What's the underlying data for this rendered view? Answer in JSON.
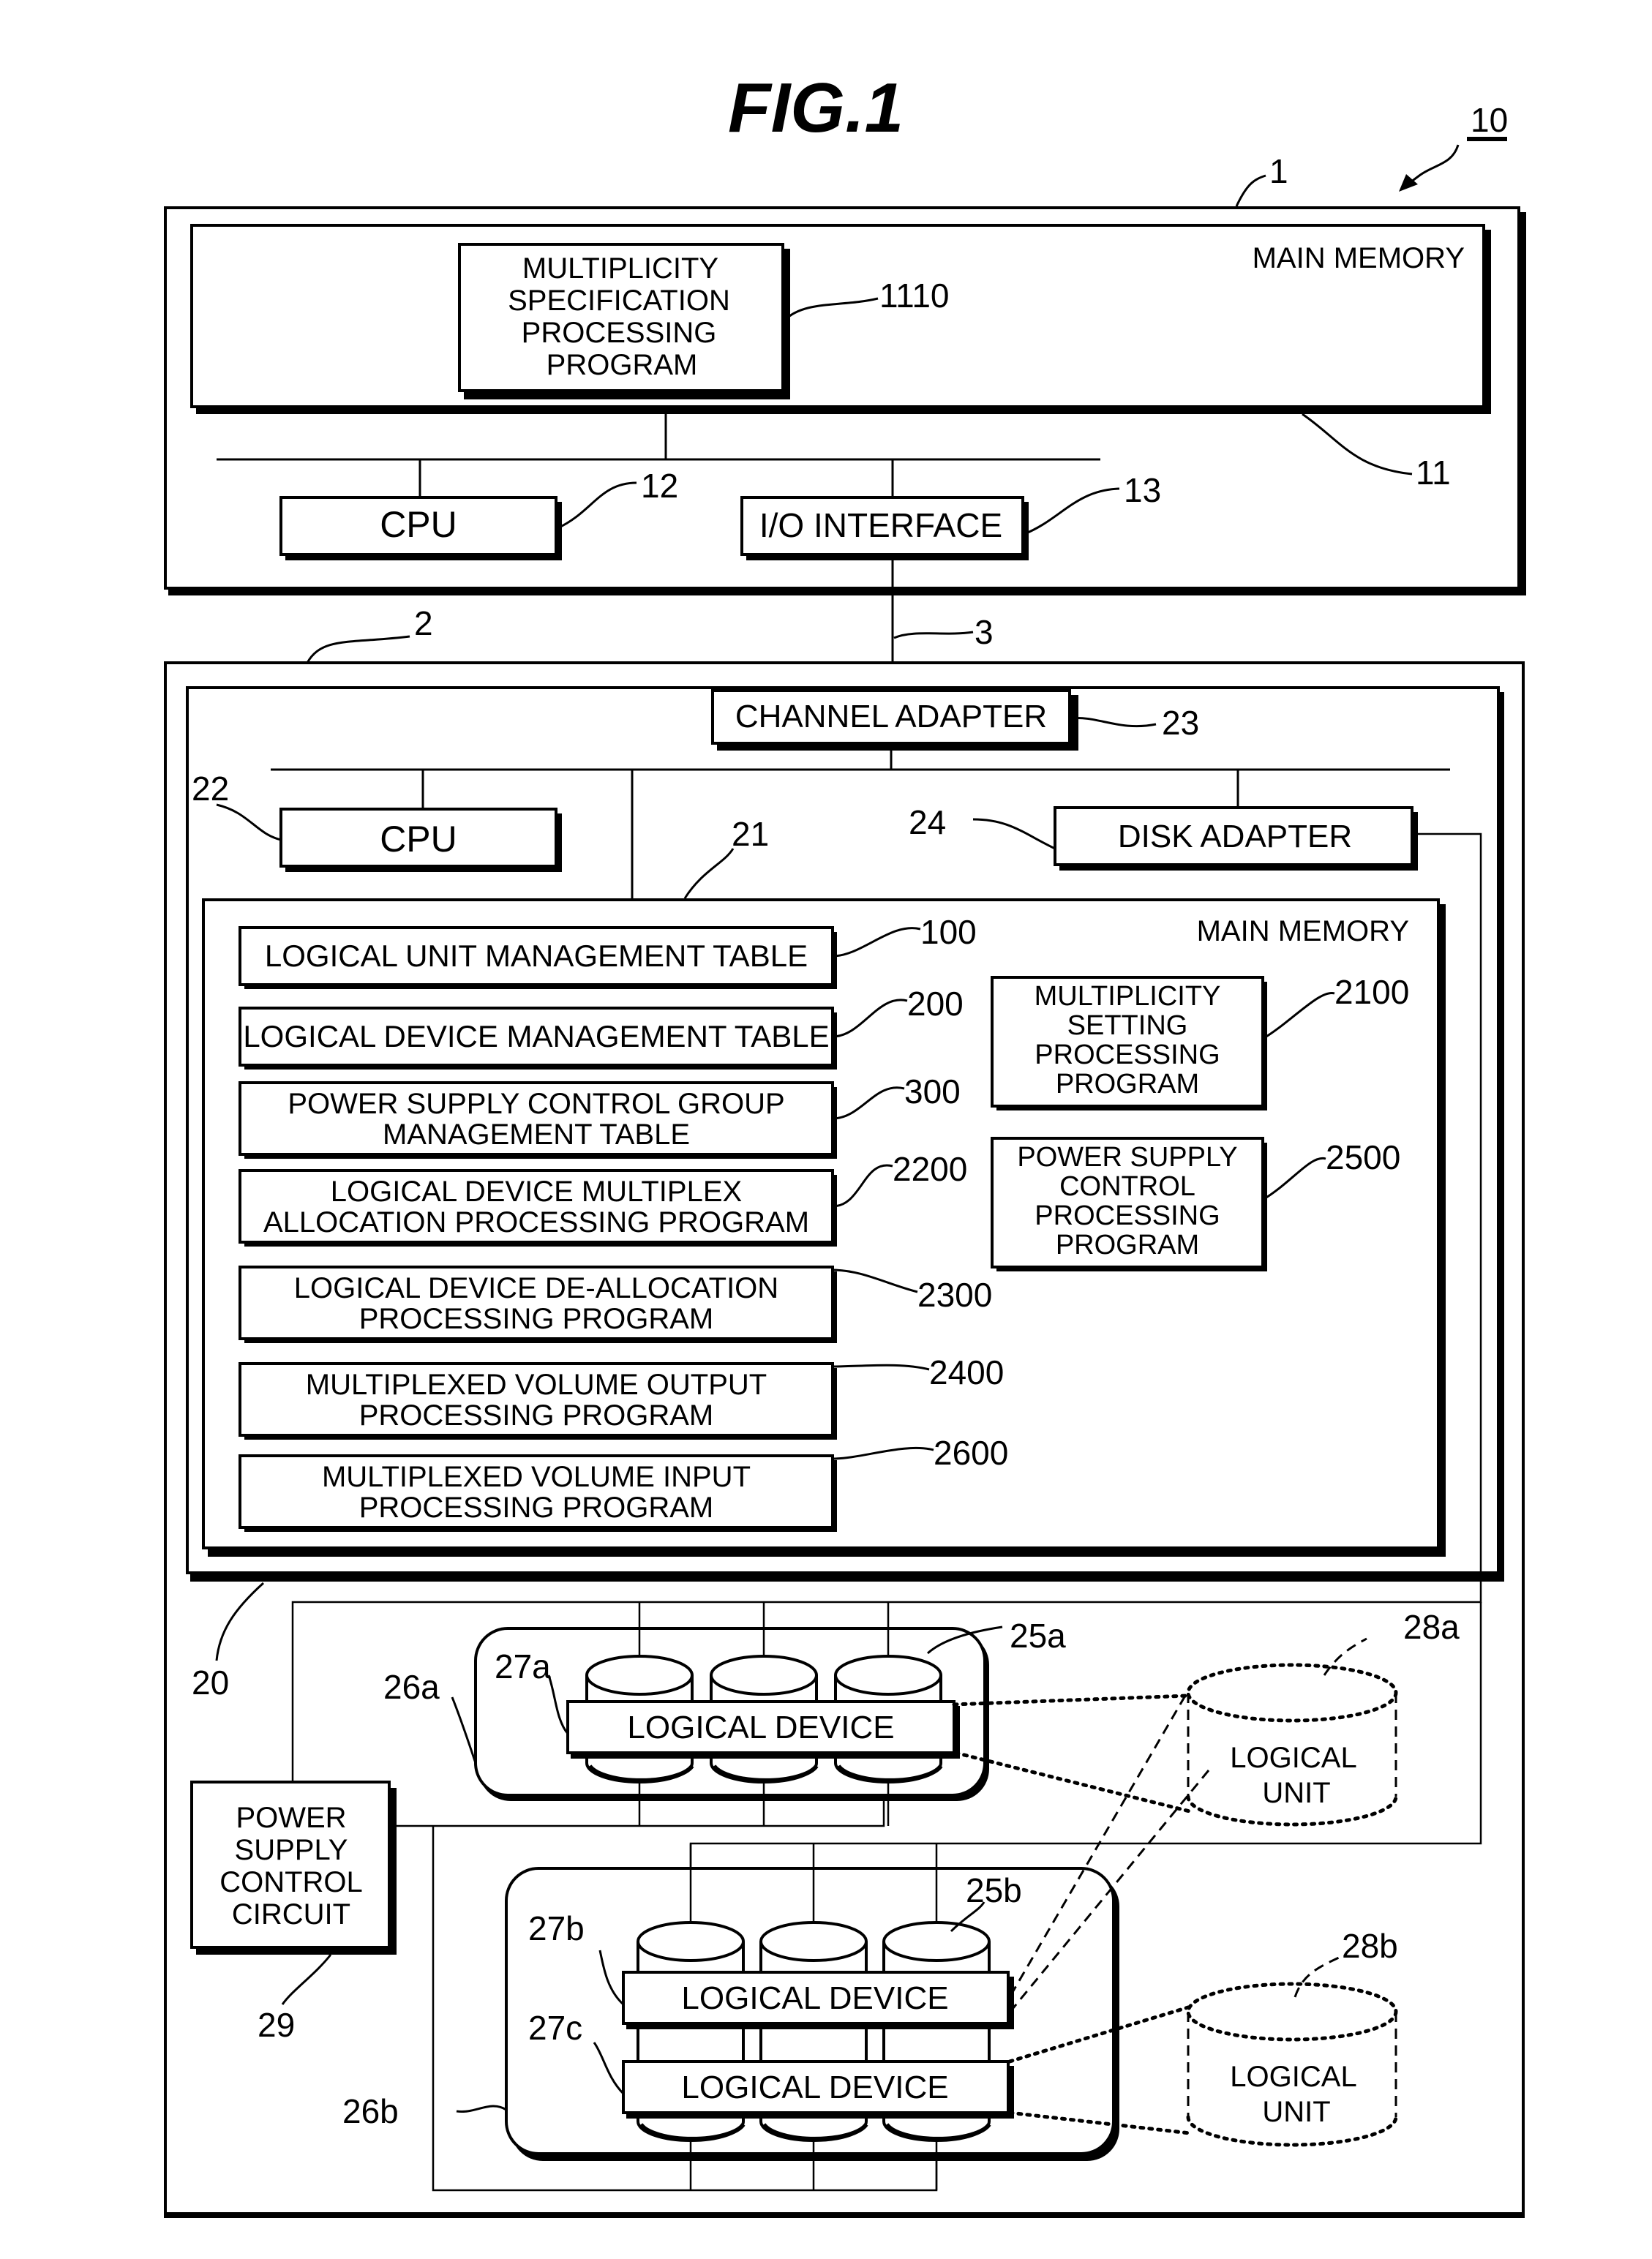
{
  "figure": {
    "title": "FIG.1",
    "system_ref": "10"
  },
  "host": {
    "ref": "1",
    "main_memory": {
      "label": "MAIN MEMORY",
      "ref": "11",
      "program": {
        "lines": [
          "MULTIPLICITY",
          "SPECIFICATION",
          "PROCESSING",
          "PROGRAM"
        ],
        "ref": "1110"
      }
    },
    "cpu": {
      "label": "CPU",
      "ref": "12"
    },
    "io_interface": {
      "label": "I/O INTERFACE",
      "ref": "13"
    }
  },
  "link": {
    "ref": "3"
  },
  "storage": {
    "ref": "2",
    "controller_ref": "20",
    "channel_adapter": {
      "label": "CHANNEL ADAPTER",
      "ref": "23"
    },
    "cpu": {
      "label": "CPU",
      "ref": "22"
    },
    "disk_adapter": {
      "label": "DISK ADAPTER",
      "ref": "24"
    },
    "main_memory": {
      "label": "MAIN MEMORY",
      "ref": "21",
      "left_items": [
        {
          "lines": [
            "LOGICAL UNIT MANAGEMENT TABLE"
          ],
          "ref": "100"
        },
        {
          "lines": [
            "LOGICAL DEVICE MANAGEMENT TABLE"
          ],
          "ref": "200"
        },
        {
          "lines": [
            "POWER SUPPLY CONTROL GROUP",
            "MANAGEMENT TABLE"
          ],
          "ref": "300"
        },
        {
          "lines": [
            "LOGICAL DEVICE MULTIPLEX",
            "ALLOCATION PROCESSING PROGRAM"
          ],
          "ref": "2200"
        },
        {
          "lines": [
            "LOGICAL DEVICE DE-ALLOCATION",
            "PROCESSING PROGRAM"
          ],
          "ref": "2300"
        },
        {
          "lines": [
            "MULTIPLEXED VOLUME OUTPUT",
            "PROCESSING PROGRAM"
          ],
          "ref": "2400"
        },
        {
          "lines": [
            "MULTIPLEXED VOLUME INPUT",
            "PROCESSING PROGRAM"
          ],
          "ref": "2600"
        }
      ],
      "right_items": [
        {
          "lines": [
            "MULTIPLICITY",
            "SETTING",
            "PROCESSING",
            "PROGRAM"
          ],
          "ref": "2100"
        },
        {
          "lines": [
            "POWER SUPPLY",
            "CONTROL",
            "PROCESSING",
            "PROGRAM"
          ],
          "ref": "2500"
        }
      ]
    },
    "power_supply_control_circuit": {
      "lines": [
        "POWER",
        "SUPPLY",
        "CONTROL",
        "CIRCUIT"
      ],
      "ref": "29"
    },
    "disk_groups": [
      {
        "ref": "26a",
        "disk_ref": "25a",
        "logical_devices": [
          {
            "label": "LOGICAL DEVICE",
            "ref": "27a"
          }
        ]
      },
      {
        "ref": "26b",
        "disk_ref": "25b",
        "logical_devices": [
          {
            "label": "LOGICAL DEVICE",
            "ref": "27b"
          },
          {
            "label": "LOGICAL DEVICE",
            "ref": "27c"
          }
        ]
      }
    ],
    "logical_units": [
      {
        "lines": [
          "LOGICAL",
          "UNIT"
        ],
        "ref": "28a"
      },
      {
        "lines": [
          "LOGICAL",
          "UNIT"
        ],
        "ref": "28b"
      }
    ]
  }
}
